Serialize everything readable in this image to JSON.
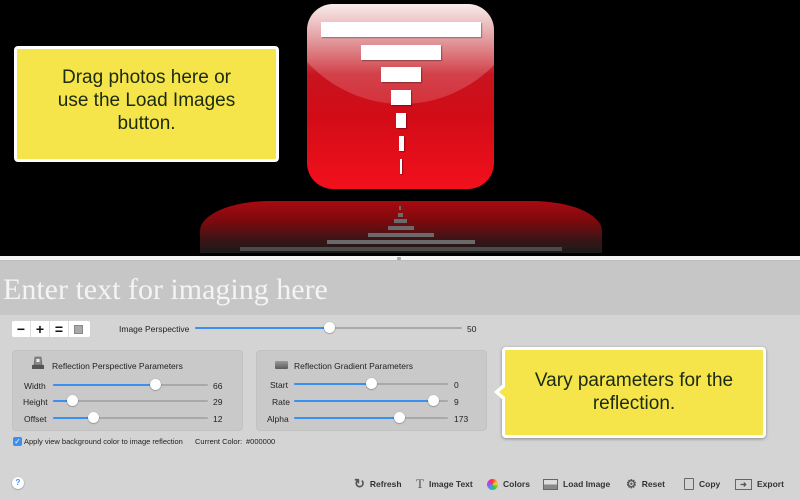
{
  "preview": {
    "callout_drag": "Drag photos here or use the Load Images button.",
    "background_color": "#000000"
  },
  "text_input": {
    "placeholder": "Enter text for imaging here",
    "value": ""
  },
  "zoom_controls": {
    "zoom_out": "−",
    "zoom_in": "+",
    "actual_size": "=",
    "fit_icon": "image-icon"
  },
  "image_perspective": {
    "label": "Image Perspective",
    "value": "50",
    "fraction": 0.5
  },
  "reflection_perspective": {
    "title": "Reflection Perspective Parameters",
    "icon": "reflection-perspective-icon",
    "sliders": [
      {
        "label": "Width",
        "value": "66",
        "fraction": 0.66
      },
      {
        "label": "Height",
        "value": "29",
        "fraction": 0.12
      },
      {
        "label": "Offset",
        "value": "12",
        "fraction": 0.26
      }
    ]
  },
  "reflection_gradient": {
    "title": "Reflection Gradient Parameters",
    "icon": "gradient-icon",
    "sliders": [
      {
        "label": "Start",
        "value": "0",
        "fraction": 0.5
      },
      {
        "label": "Rate",
        "value": "9",
        "fraction": 0.9
      },
      {
        "label": "Alpha",
        "value": "173",
        "fraction": 0.68
      }
    ]
  },
  "callout_params": "Vary parameters for the reflection.",
  "apply_background": {
    "label": "Apply view background color to image reflection",
    "checked": true
  },
  "current_color": {
    "label": "Current Color:",
    "value": "#000000"
  },
  "help": "?",
  "toolbar": {
    "refresh": "Refresh",
    "image_text": "Image Text",
    "colors": "Colors",
    "load_image": "Load Image",
    "reset": "Reset",
    "copy": "Copy",
    "export": "Export"
  },
  "colors": {
    "accent": "#3b8ff0",
    "callout": "#f5e44a",
    "icon_red": "#d10c17"
  }
}
